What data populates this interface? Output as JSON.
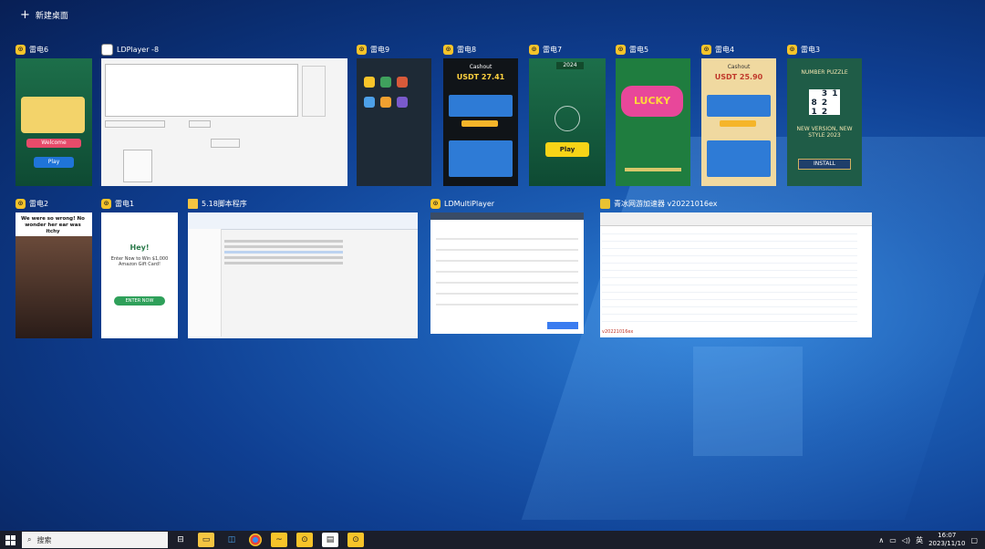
{
  "new_desktop_label": "新建桌面",
  "windows_row1": [
    {
      "id": "w1",
      "title": "雷电6"
    },
    {
      "id": "w2",
      "title": "LDPlayer -8"
    },
    {
      "id": "w3",
      "title": "雷电9"
    },
    {
      "id": "w4",
      "title": "雷电8"
    },
    {
      "id": "w5",
      "title": "雷电7"
    },
    {
      "id": "w6",
      "title": "雷电5"
    },
    {
      "id": "w7",
      "title": "雷电4"
    },
    {
      "id": "w8",
      "title": "雷电3"
    }
  ],
  "windows_row2": [
    {
      "id": "w9",
      "title": "雷电2"
    },
    {
      "id": "w10",
      "title": "雷电1"
    },
    {
      "id": "w11",
      "title": "5.18脚本程序"
    },
    {
      "id": "w12",
      "title": "LDMultiPlayer"
    },
    {
      "id": "w13",
      "title": "青冰网游加速器 v20221016ex"
    }
  ],
  "thumbs": {
    "cashout_title": "Cashout",
    "cashout_amount": "USDT 27.41",
    "cashout_amount2": "USDT 25.90",
    "play": "Play",
    "play_amount": "2024",
    "welcome": "Welcome",
    "lucky": "LUCKY",
    "number_puzzle": "NUMBER PUZZLE",
    "new_version": "NEW VERSION, NEW STYLE 2023",
    "install": "INSTALL",
    "wrong_caption": "We were so wrong! No wonder her ear was itchy",
    "hey": "Hey!",
    "gift_card": "Enter Now to Win $1,000 Amazon Gift Card!",
    "enter_now": "ENTER NOW",
    "multi_title": "LDMultiPlayer",
    "accel_footer": "v20221016ex"
  },
  "taskbar": {
    "search_placeholder": "搜索",
    "lang": "英",
    "time": "16:07",
    "date": "2023/11/10"
  }
}
